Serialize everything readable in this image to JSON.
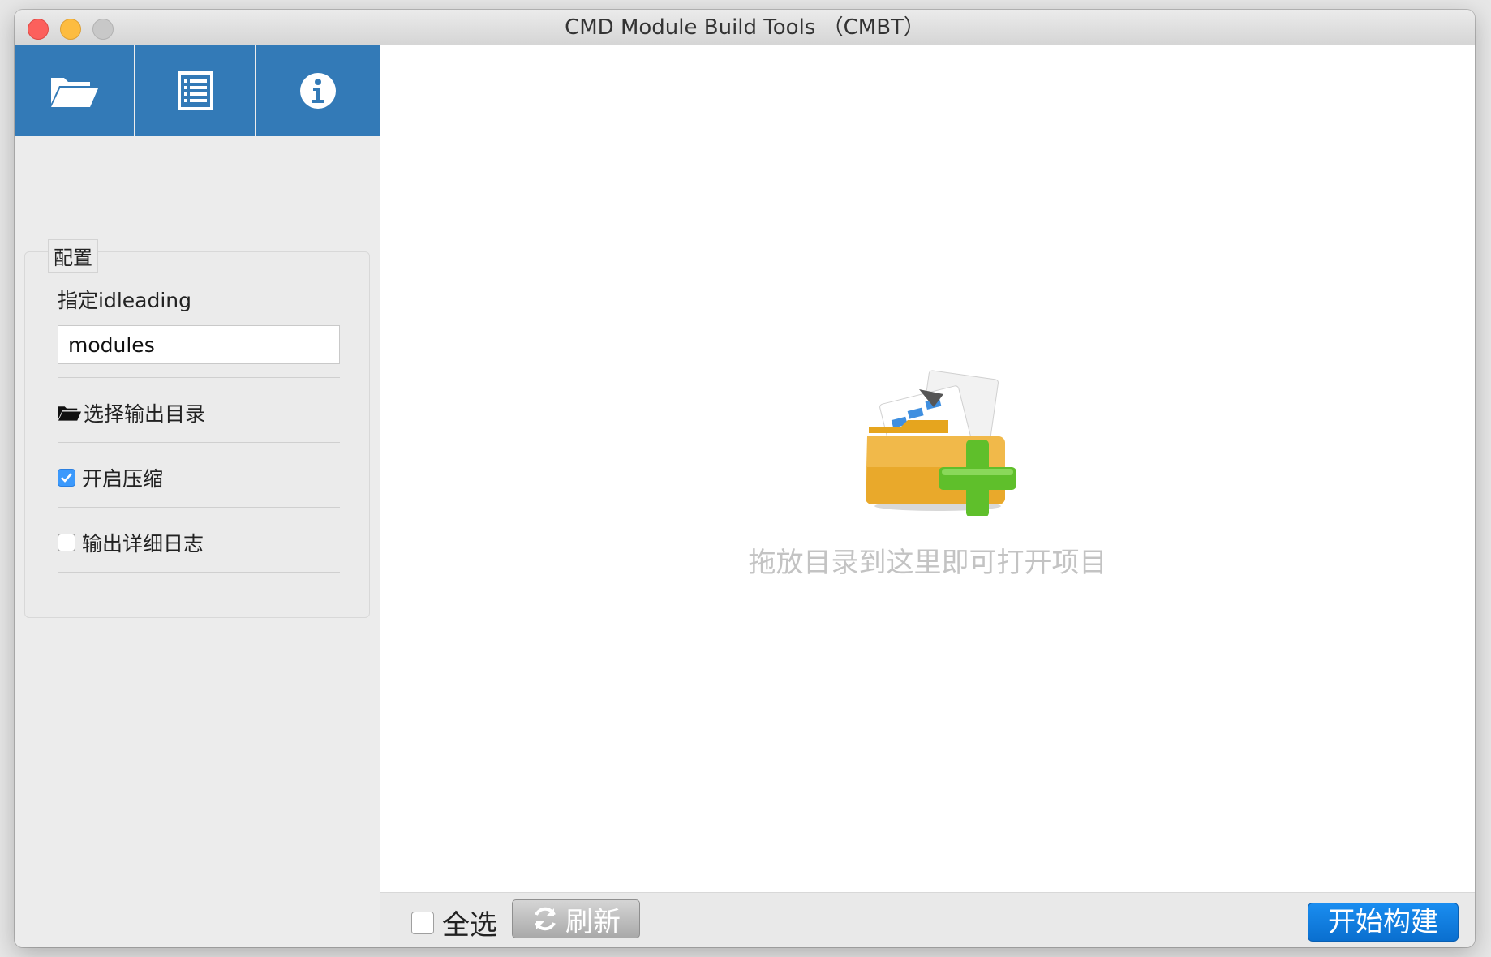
{
  "window": {
    "title": "CMD Module Build Tools （CMBT）"
  },
  "toolbar": {
    "icons": [
      "open-folder-icon",
      "list-icon",
      "info-icon"
    ],
    "accent": "#337ab7"
  },
  "config": {
    "legend": "配置",
    "idleading_label": "指定idleading",
    "idleading_value": "modules",
    "output_dir_label": "选择输出目录",
    "compress_label": "开启压缩",
    "compress_checked": true,
    "verbose_log_label": "输出详细日志",
    "verbose_log_checked": false
  },
  "main": {
    "drop_hint": "拖放目录到这里即可打开项目"
  },
  "footer": {
    "select_all_label": "全选",
    "refresh_label": "刷新",
    "build_label": "开始构建",
    "build_color": "#0a7bdf"
  }
}
